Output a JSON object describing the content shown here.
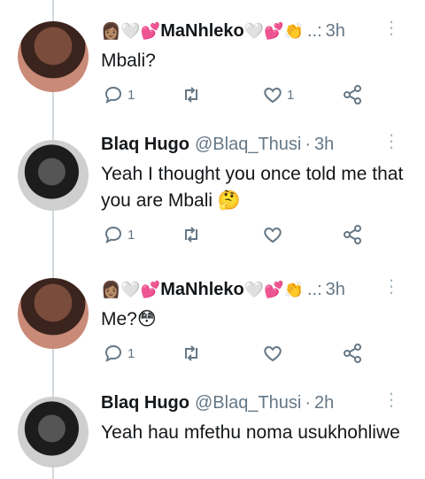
{
  "tweets": [
    {
      "emoji_prefix": "👩🏽🤍💕",
      "name": "MaNhleko",
      "emoji_suffix": "🤍💕👏",
      "handle": "",
      "sep": "..:",
      "time": "3h",
      "text": "Mbali?",
      "reply_count": "1",
      "like_count": "1"
    },
    {
      "emoji_prefix": "",
      "name": "Blaq Hugo",
      "emoji_suffix": "",
      "handle": "@Blaq_Thusi",
      "sep": "·",
      "time": "3h",
      "text": "Yeah I thought you once told me that you are Mbali 🤔",
      "reply_count": "1",
      "like_count": ""
    },
    {
      "emoji_prefix": "👩🏽🤍💕",
      "name": "MaNhleko",
      "emoji_suffix": "🤍💕👏",
      "handle": "",
      "sep": "..:",
      "time": "3h",
      "text": "Me?😳",
      "reply_count": "1",
      "like_count": ""
    },
    {
      "emoji_prefix": "",
      "name": "Blaq Hugo",
      "emoji_suffix": "",
      "handle": "@Blaq_Thusi",
      "sep": "·",
      "time": "2h",
      "text": "Yeah hau mfethu noma usukhohliwe",
      "reply_count": "",
      "like_count": ""
    }
  ],
  "icons": {
    "reply": "reply-icon",
    "retweet": "retweet-icon",
    "like": "heart-icon",
    "share": "share-icon",
    "more": "more-vertical-icon"
  },
  "colors": {
    "text": "#14171a",
    "muted": "#657786",
    "line": "#cfd9de"
  }
}
